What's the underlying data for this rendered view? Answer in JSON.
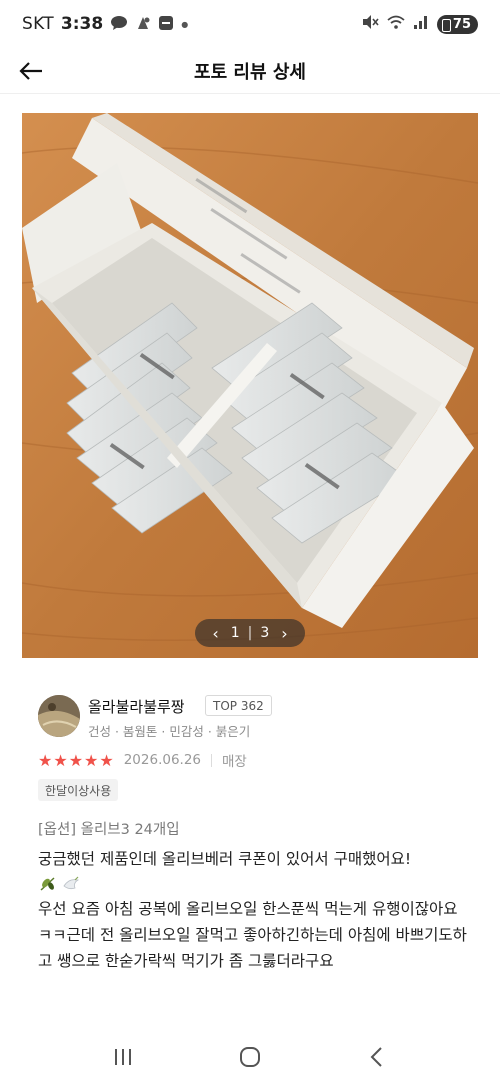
{
  "status_bar": {
    "carrier": "SKT",
    "time": "3:38",
    "battery": "75",
    "icons": [
      "chat-bubble-icon",
      "notification-icon",
      "app-icon",
      "more-dot",
      "mute-icon",
      "wifi-icon",
      "signal-icon",
      "battery-icon"
    ]
  },
  "header": {
    "title": "포토 리뷰 상세",
    "back_icon": "arrow-left-icon"
  },
  "photo": {
    "pager_current": "1",
    "pager_separator": "|",
    "pager_total": "3"
  },
  "reviewer": {
    "nickname": "올라불라불루짱",
    "rank_badge": "TOP 362",
    "skin_info": "건성 · 봄웜톤 · 민감성 · 붉은기"
  },
  "review": {
    "rating": 5,
    "rating_max": 5,
    "date": "2026.06.26",
    "channel": "매장",
    "usage_tag": "한달이상사용",
    "option": "[옵션] 올리브3 24개입",
    "body_lines": [
      "궁금했던 제품인데 올리브베러 쿠폰이 있어서 구매했어요!",
      "우선 요즘 아침 공복에 올리브오일 한스푼씩 먹는게 유행이잖아요ㅋㅋ근데 전 올리브오일 잘먹고 좋아하긴하는데 아침에 바쁘기도하고 쌩으로 한숟가락씩 먹기가 좀 그룷더라구요"
    ],
    "emoji_icons": [
      "olive-emoji-icon",
      "dove-emoji-icon"
    ]
  },
  "nav_bar": {
    "icons": [
      "recent-apps-icon",
      "home-icon",
      "back-icon"
    ]
  },
  "colors": {
    "star": "#f0524a",
    "wood": "#c07a3c"
  }
}
